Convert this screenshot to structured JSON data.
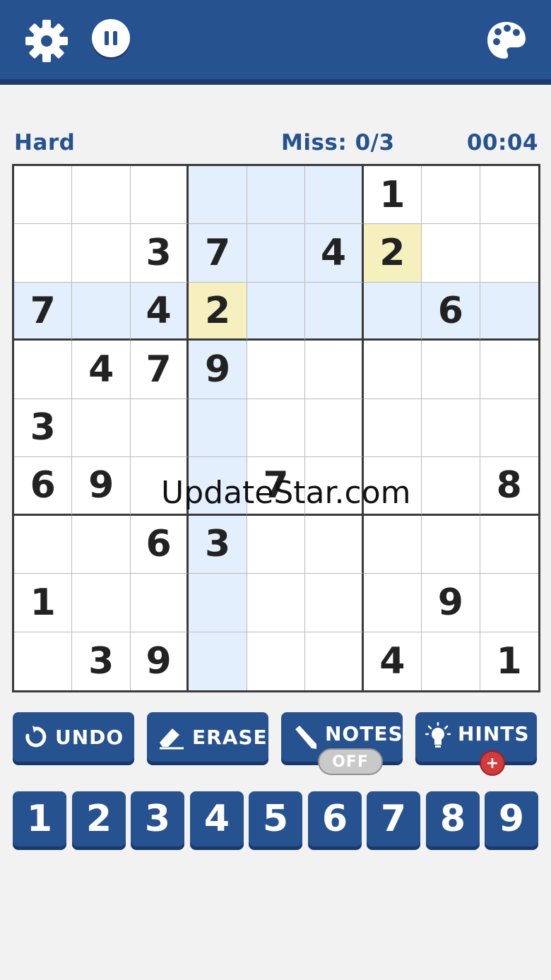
{
  "header": {
    "settings_icon": "gear-icon",
    "pause_icon": "pause-icon",
    "theme_icon": "palette-icon"
  },
  "status": {
    "difficulty": "Hard",
    "misses": "Miss: 0/3",
    "timer": "00:04"
  },
  "board": {
    "grid": [
      [
        "",
        "",
        "",
        "",
        "",
        "",
        "1",
        "",
        ""
      ],
      [
        "",
        "",
        "3",
        "7",
        "",
        "4",
        "2",
        "",
        ""
      ],
      [
        "7",
        "",
        "4",
        "2",
        "",
        "",
        "",
        "6",
        ""
      ],
      [
        "",
        "4",
        "7",
        "9",
        "",
        "",
        "",
        "",
        ""
      ],
      [
        "3",
        "",
        "",
        "",
        "",
        "",
        "",
        "",
        ""
      ],
      [
        "6",
        "9",
        "",
        "",
        "7",
        "",
        "",
        "",
        "8"
      ],
      [
        "",
        "",
        "6",
        "3",
        "",
        "",
        "",
        "",
        ""
      ],
      [
        "1",
        "",
        "",
        "",
        "",
        "",
        "",
        "9",
        ""
      ],
      [
        "",
        "3",
        "9",
        "",
        "",
        "",
        "4",
        "",
        "1"
      ]
    ],
    "highlight_color": "#e4effd",
    "selected_color": "#f6efbe"
  },
  "watermark": "UpdateStar.com",
  "tools": {
    "undo": "UNDO",
    "erase": "ERASE",
    "notes": "NOTES",
    "notes_state": "OFF",
    "hints": "HINTS",
    "hints_badge": "+"
  },
  "number_pad": [
    "1",
    "2",
    "3",
    "4",
    "5",
    "6",
    "7",
    "8",
    "9"
  ],
  "colors": {
    "primary": "#265290",
    "background": "#f2f2f2",
    "badge": "#d23b3b"
  }
}
